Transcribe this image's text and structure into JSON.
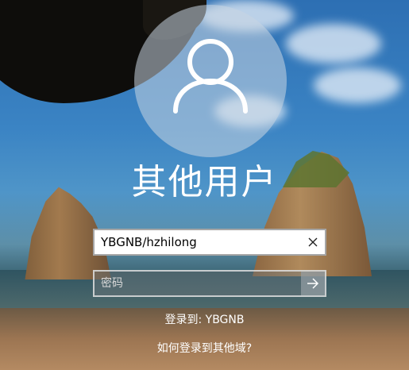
{
  "login": {
    "title": "其他用户",
    "username_value": "YBGNB/hzhilong",
    "password_placeholder": "密码",
    "sign_in_to": "登录到: YBGNB",
    "other_domain_link": "如何登录到其他域?"
  },
  "icons": {
    "avatar": "user-silhouette-icon",
    "clear": "close-icon",
    "submit": "arrow-right-icon"
  },
  "colors": {
    "text": "#ffffff",
    "field_border": "#a6a6a6",
    "avatar_bg": "#c8d6e2"
  }
}
